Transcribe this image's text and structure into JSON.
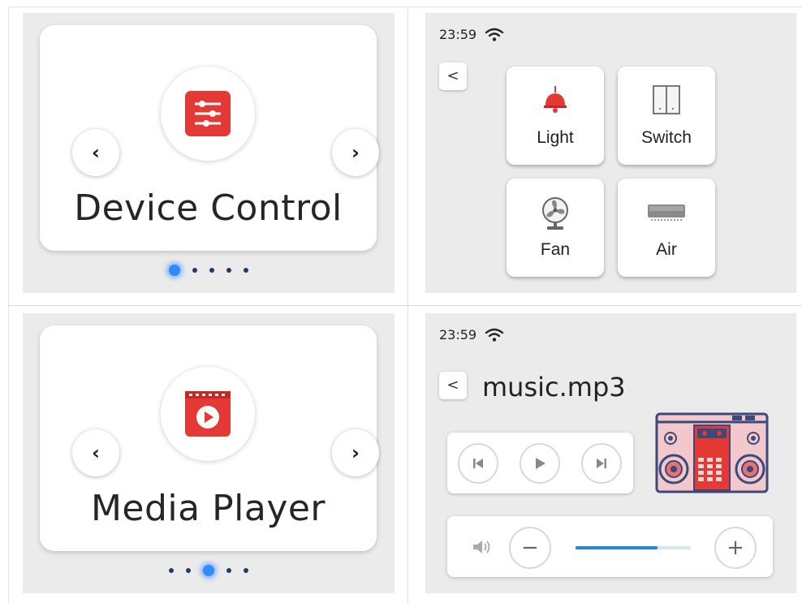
{
  "carousel_device": {
    "title": "Device Control",
    "icon": "sliders-icon",
    "prev_label": "‹",
    "next_label": "›",
    "page_count": 5,
    "active_page": 1
  },
  "device_screen": {
    "time": "23:59",
    "back_label": "<",
    "tiles": [
      {
        "label": "Light",
        "icon": "lamp-icon"
      },
      {
        "label": "Switch",
        "icon": "switch-icon"
      },
      {
        "label": "Fan",
        "icon": "fan-icon"
      },
      {
        "label": "Air",
        "icon": "air-conditioner-icon"
      }
    ]
  },
  "carousel_media": {
    "title": "Media Player",
    "icon": "video-play-icon",
    "prev_label": "‹",
    "next_label": "›",
    "page_count": 5,
    "active_page": 3
  },
  "media_screen": {
    "time": "23:59",
    "back_label": "<",
    "track": "music.mp3",
    "volume_minus": "−",
    "volume_plus": "+",
    "volume_level": 0.71
  },
  "colors": {
    "accent": "#2f8bff",
    "icon_red": "#e53935",
    "panel_bg": "#ebebeb",
    "slider_fill": "#1e88e5"
  }
}
